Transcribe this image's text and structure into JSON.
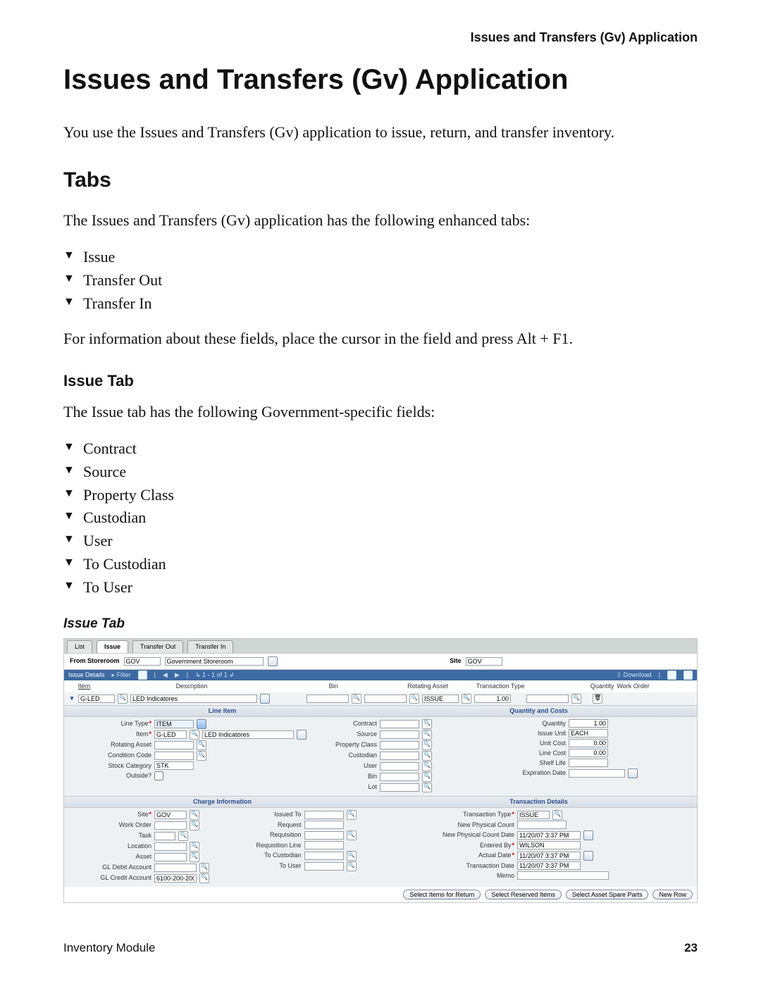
{
  "header": {
    "running_head": "Issues and Transfers (Gv) Application"
  },
  "title": "Issues and Transfers (Gv) Application",
  "intro": "You use the Issues and Transfers (Gv) application to issue, return, and transfer inventory.",
  "tabs_section": {
    "heading": "Tabs",
    "intro": "The Issues and Transfers (Gv) application has the following enhanced tabs:",
    "items": [
      "Issue",
      "Transfer Out",
      "Transfer In"
    ],
    "hint": "For information about these fields, place the cursor in the field and press Alt + F1."
  },
  "issue_section": {
    "heading": "Issue Tab",
    "intro": "The Issue tab has the following Government-specific fields:",
    "fields": [
      "Contract",
      "Source",
      "Property Class",
      "Custodian",
      "User",
      "To Custodian",
      "To User"
    ],
    "caption": "Issue Tab"
  },
  "app": {
    "tabs": {
      "list": "List",
      "issue": "Issue",
      "transfer_out": "Transfer Out",
      "transfer_in": "Transfer In"
    },
    "top": {
      "from_storeroom_label": "From Storeroom",
      "from_storeroom": "GOV",
      "from_storeroom_desc": "Government Storeroom",
      "site_label": "Site",
      "site": "GOV"
    },
    "bluebar": {
      "title": "Issue Details",
      "filter": "Filter",
      "range": "1 - 1 of 1",
      "download": "Download"
    },
    "cols": {
      "item": "Item",
      "description": "Description",
      "bin": "Bin",
      "rotating_asset": "Rotating Asset",
      "transaction_type": "Transaction Type",
      "quantity": "Quantity",
      "work_order": "Work Order"
    },
    "row": {
      "item": "G-LED",
      "description": "LED Indicatores",
      "bin": "",
      "rotating_asset": "",
      "transaction_type": "ISSUE",
      "quantity": "1.00",
      "work_order": ""
    },
    "sect": {
      "line_item": "Line Item",
      "quantity_costs": "Quantity and Costs",
      "charge_info": "Charge Information",
      "transaction_details": "Transaction Details"
    },
    "line_item": {
      "line_type_label": "Line Type",
      "line_type": "ITEM",
      "item_label": "Item",
      "item": "G-LED",
      "item_desc": "LED Indicatores",
      "rotating_asset_label": "Rotating Asset",
      "condition_code_label": "Condition Code",
      "stock_category_label": "Stock Category",
      "stock_category": "STK",
      "outside_label": "Outside?",
      "contract_label": "Contract",
      "source_label": "Source",
      "property_class_label": "Property Class",
      "custodian_label": "Custodian",
      "user_label": "User",
      "bin_label": "Bin",
      "lot_label": "Lot"
    },
    "qcosts": {
      "quantity_label": "Quantity",
      "quantity": "1.00",
      "issue_unit_label": "Issue Unit",
      "issue_unit": "EACH",
      "unit_cost_label": "Unit Cost",
      "unit_cost": "0.00",
      "line_cost_label": "Line Cost",
      "line_cost": "0.00",
      "shelf_life_label": "Shelf Life",
      "expiration_date_label": "Expiration Date"
    },
    "charge": {
      "site_label": "Site",
      "site": "GOV",
      "work_order_label": "Work Order",
      "task_label": "Task",
      "location_label": "Location",
      "asset_label": "Asset",
      "gl_debit_label": "GL Debit Account",
      "gl_credit_label": "GL Credit Account",
      "gl_credit": "6100-200-200",
      "issued_to_label": "Issued To",
      "request_label": "Request",
      "requisition_label": "Requisition",
      "requisition_line_label": "Requisition Line",
      "to_custodian_label": "To Custodian",
      "to_user_label": "To User"
    },
    "txn": {
      "type_label": "Transaction Type",
      "type": "ISSUE",
      "new_count_label": "New Physical Count",
      "new_count_date_label": "New Physical Count Date",
      "new_count_date": "11/20/07 3:37 PM",
      "entered_by_label": "Entered By",
      "entered_by": "WILSON",
      "actual_date_label": "Actual Date",
      "actual_date": "11/20/07 3:37 PM",
      "transaction_date_label": "Transaction Date",
      "transaction_date": "11/20/07 3:37 PM",
      "memo_label": "Memo"
    },
    "buttons": {
      "select_return": "Select Items for Return",
      "select_reserved": "Select Reserved Items",
      "select_spare": "Select Asset Spare Parts",
      "new_row": "New Row"
    }
  },
  "footer": {
    "left": "Inventory Module",
    "page": "23"
  }
}
